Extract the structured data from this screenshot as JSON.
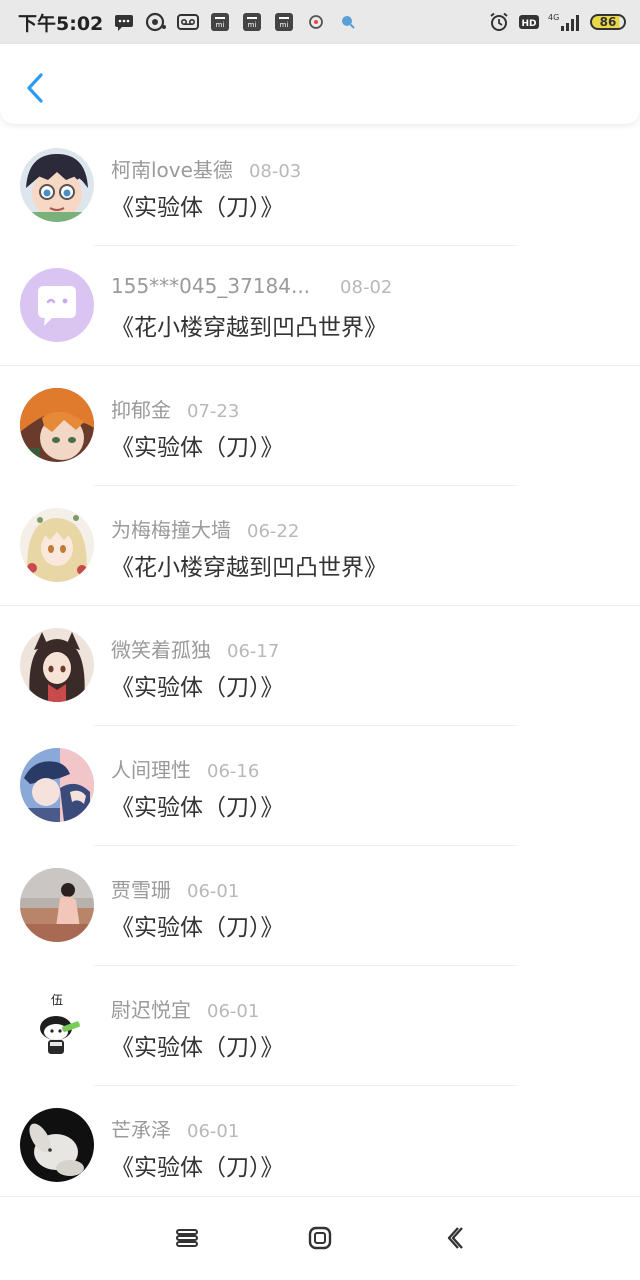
{
  "status_bar": {
    "time": "下午5:02",
    "network": "4G",
    "hd": "HD",
    "battery": "86",
    "left_icons": [
      "message-icon",
      "chat-icon",
      "voicemail-icon",
      "mi-icon",
      "mi-icon",
      "mi-icon",
      "app-icon",
      "search-app-icon"
    ],
    "right_icons": [
      "alarm-icon",
      "hd-icon",
      "signal-icon",
      "battery-icon"
    ]
  },
  "header": {
    "back_icon": "chevron-left-icon",
    "accent_color": "#2d9bf0"
  },
  "comments": [
    {
      "user": "柯南love基德",
      "date": "08-03",
      "title": "《实验体（刀）》",
      "avatar": "avatar-anime-boy-glasses"
    },
    {
      "user": "155***045_37184...",
      "date": "08-02",
      "title": "《花小楼穿越到凹凸世界》",
      "avatar": "avatar-default-chat"
    },
    {
      "user": "抑郁金",
      "date": "07-23",
      "title": "《实验体（刀）》",
      "avatar": "avatar-anime-orange-hair"
    },
    {
      "user": "为梅梅撞大墙",
      "date": "06-22",
      "title": "《花小楼穿越到凹凸世界》",
      "avatar": "avatar-anime-girl-blonde"
    },
    {
      "user": "微笑着孤独",
      "date": "06-17",
      "title": "《实验体（刀）》",
      "avatar": "avatar-anime-girl-dark-hair"
    },
    {
      "user": "人间理性",
      "date": "06-16",
      "title": "《实验体（刀）》",
      "avatar": "avatar-anime-blue-hat"
    },
    {
      "user": "贾雪珊",
      "date": "06-01",
      "title": "《实验体（刀）》",
      "avatar": "avatar-photo-girl"
    },
    {
      "user": "尉迟悦宜",
      "date": "06-01",
      "title": "《实验体（刀）》",
      "avatar": "avatar-cartoon-sticker",
      "avatar_text": "伍"
    },
    {
      "user": "芒承泽",
      "date": "06-01",
      "title": "《实验体（刀）》",
      "avatar": "avatar-plush-bunny"
    }
  ],
  "nav_bar": {
    "icons": [
      "menu-icon",
      "home-icon",
      "back-icon"
    ]
  }
}
